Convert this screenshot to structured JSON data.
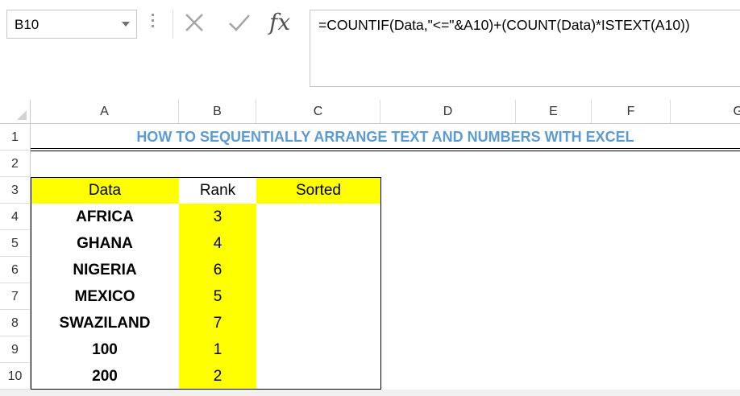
{
  "name_box": {
    "value": "B10"
  },
  "formula_bar": {
    "fx_label": "fx",
    "formula": "=COUNTIF(Data,\"<=\"&A10)+(COUNT(Data)*ISTEXT(A10))"
  },
  "columns": [
    "A",
    "B",
    "C",
    "D",
    "E",
    "F",
    "G"
  ],
  "rows": [
    "1",
    "2",
    "3",
    "4",
    "5",
    "6",
    "7",
    "8",
    "9",
    "10"
  ],
  "sheet": {
    "title": "HOW TO SEQUENTIALLY ARRANGE TEXT AND NUMBERS WITH EXCEL",
    "headers": {
      "data": "Data",
      "rank": "Rank",
      "sorted": "Sorted"
    },
    "data": [
      "AFRICA",
      "GHANA",
      "NIGERIA",
      "MEXICO",
      "SWAZILAND",
      "100",
      "200"
    ],
    "rank": [
      "3",
      "4",
      "6",
      "5",
      "7",
      "1",
      "2"
    ]
  },
  "colors": {
    "highlight": "#ffff00",
    "title": "#5b9bd5"
  }
}
